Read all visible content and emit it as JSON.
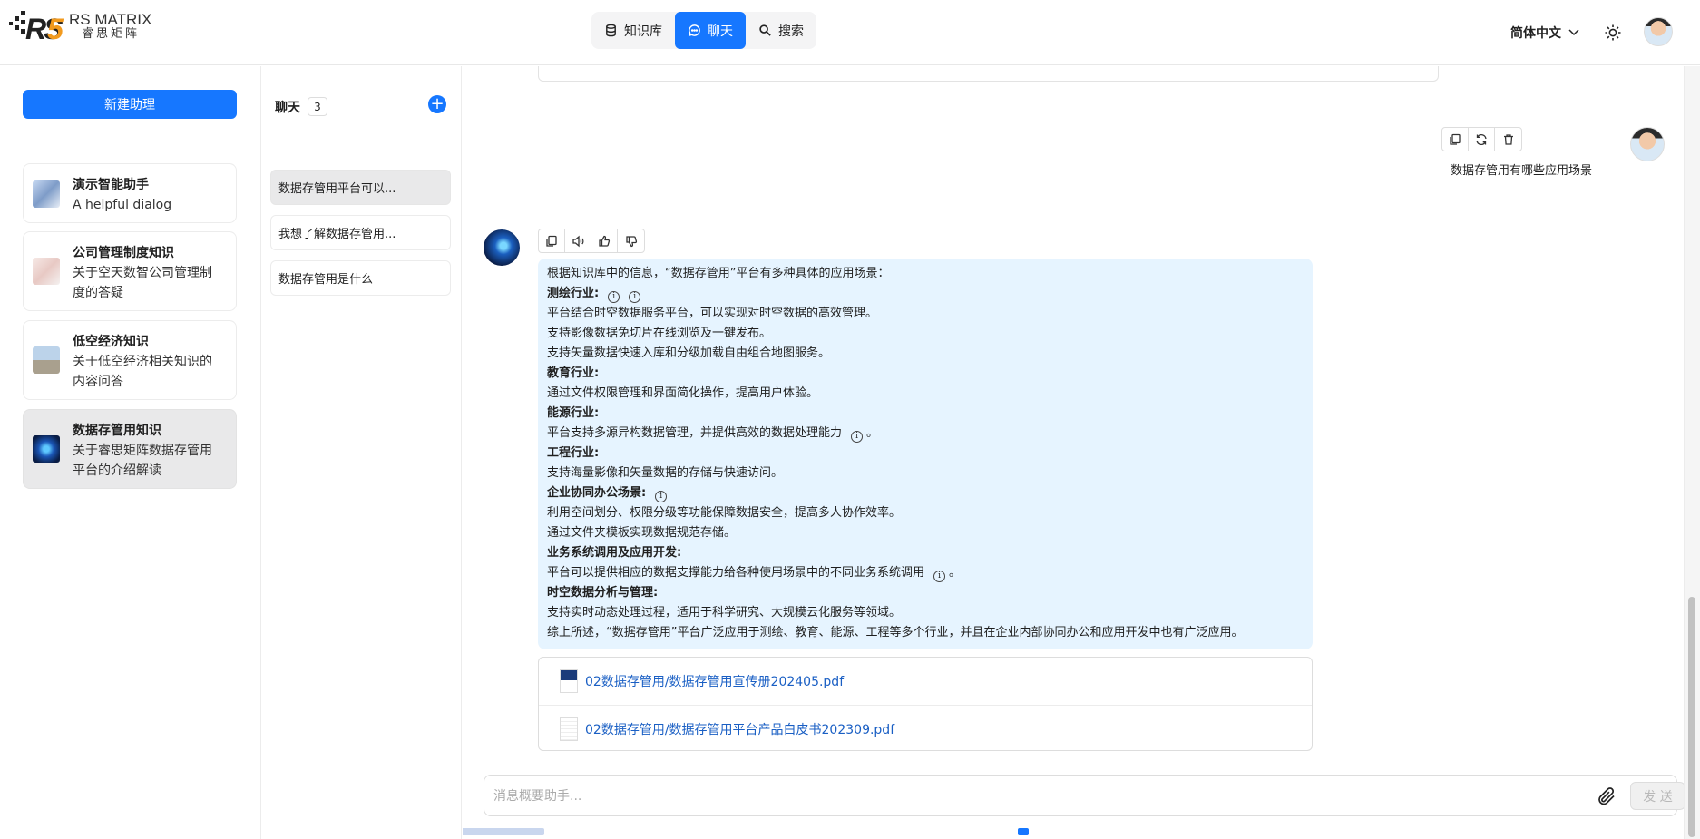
{
  "brand": {
    "name_en": "RS MATRIX",
    "name_cn": "睿思矩阵",
    "logo_letters": "RS",
    "logo_number": "5"
  },
  "top_tabs": [
    {
      "label": "知识库",
      "icon": "database-icon",
      "active": false
    },
    {
      "label": "聊天",
      "icon": "chat-bubble-icon",
      "active": true
    },
    {
      "label": "搜索",
      "icon": "search-icon",
      "active": false
    }
  ],
  "header": {
    "language": "简体中文",
    "theme_icon": "sun-icon"
  },
  "colors": {
    "accent": "#1677ff",
    "answer_bg": "#e6f4ff",
    "link": "#1a5fc4"
  },
  "left_panel": {
    "new_button": "新建助理",
    "assistants": [
      {
        "title": "演示智能助手",
        "desc": "A helpful dialog",
        "active": false
      },
      {
        "title": "公司管理制度知识",
        "desc": "关于空天数智公司管理制度的答疑",
        "active": false
      },
      {
        "title": "低空经济知识",
        "desc": "关于低空经济相关知识的内容问答",
        "active": false
      },
      {
        "title": "数据存管用知识",
        "desc": "关于睿思矩阵数据存管用平台的介绍解读",
        "active": true
      }
    ]
  },
  "chat_list": {
    "title": "聊天",
    "count": "3",
    "items": [
      {
        "label": "数据存管用平台可以...",
        "active": true
      },
      {
        "label": "我想了解数据存管用...",
        "active": false
      },
      {
        "label": "数据存管用是什么",
        "active": false
      }
    ]
  },
  "conversation": {
    "user_message": "数据存管用有哪些应用场景",
    "answer": {
      "intro": "根据知识库中的信息，“数据存管用”平台有多种具体的应用场景：",
      "sections": [
        {
          "heading": "测绘行业:",
          "lines": [
            "平台结合时空数据服务平台，可以实现对时空数据的高效管理。",
            "支持影像数据免切片在线浏览及一键发布。",
            "支持矢量数据快速入库和分级加载自由组合地图服务。"
          ]
        },
        {
          "heading": "教育行业:",
          "lines": [
            "通过文件权限管理和界面简化操作，提高用户体验。"
          ]
        },
        {
          "heading": "能源行业:",
          "lines": [
            "平台支持多源异构数据管理，并提供高效的数据处理能力"
          ]
        },
        {
          "heading": "工程行业:",
          "lines": [
            "支持海量影像和矢量数据的存储与快速访问。"
          ]
        },
        {
          "heading": "企业协同办公场景:",
          "lines": [
            "利用空间划分、权限分级等功能保障数据安全，提高多人协作效率。",
            "通过文件夹模板实现数据规范存储。"
          ]
        },
        {
          "heading": "业务系统调用及应用开发:",
          "lines": [
            "平台可以提供相应的数据支撑能力给各种使用场景中的不同业务系统调用"
          ]
        },
        {
          "heading": "时空数据分析与管理:",
          "lines": [
            "支持实时动态处理过程，适用于科学研究、大规模云化服务等领域。"
          ]
        }
      ],
      "summary": "综上所述，“数据存管用”平台广泛应用于测绘、教育、能源、工程等多个行业，并且在企业内部协同办公和应用开发中也有广泛应用。",
      "period": "。",
      "info_icon": "i"
    },
    "files": [
      "02数据存管用/数据存管用宣传册202405.pdf",
      "02数据存管用/数据存管用平台产品白皮书202309.pdf"
    ]
  },
  "composer": {
    "placeholder": "消息概要助手...",
    "send_label": "发 送"
  }
}
